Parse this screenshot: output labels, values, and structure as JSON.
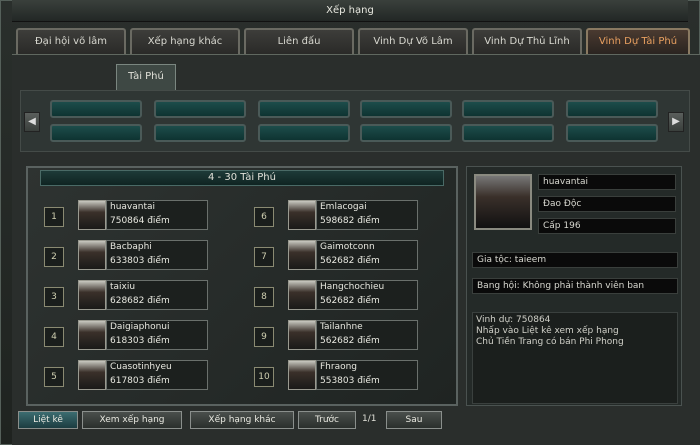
{
  "window": {
    "title": "Xếp hạng"
  },
  "tabs": [
    {
      "label": "Đại hội võ lâm",
      "active": false
    },
    {
      "label": "Xếp hạng khác",
      "active": false
    },
    {
      "label": "Liên đấu",
      "active": false
    },
    {
      "label": "Vinh Dự Võ Lâm",
      "active": false
    },
    {
      "label": "Vinh Dự Thủ Lĩnh",
      "active": false
    },
    {
      "label": "Vinh Dự Tài Phú",
      "active": true
    }
  ],
  "subtab": {
    "label": "Tài Phú"
  },
  "strip": {
    "left_arrow": "◀",
    "right_arrow": "▶"
  },
  "ranking": {
    "header": "4 - 30 Tài Phú",
    "entries": [
      {
        "rank": "1",
        "name": "huavantai",
        "score": "750864 điểm"
      },
      {
        "rank": "2",
        "name": "Bacbaphi",
        "score": "633803 điểm"
      },
      {
        "rank": "3",
        "name": "taixiu",
        "score": "628682 điểm"
      },
      {
        "rank": "4",
        "name": "Daigiaphonui",
        "score": "618303 điểm"
      },
      {
        "rank": "5",
        "name": "Cuasotinhyeu",
        "score": "617803 điểm"
      },
      {
        "rank": "6",
        "name": "Emlacogai",
        "score": "598682 điểm"
      },
      {
        "rank": "7",
        "name": "Gaimotconn",
        "score": "562682 điểm"
      },
      {
        "rank": "8",
        "name": "Hangchochieu",
        "score": "562682 điểm"
      },
      {
        "rank": "9",
        "name": "Tailanhne",
        "score": "562682 điểm"
      },
      {
        "rank": "10",
        "name": "Fhraong",
        "score": "553803 điểm"
      }
    ]
  },
  "profile": {
    "name": "huavantai",
    "faction": "Đao Độc",
    "level": "Cấp 196",
    "family": "Gia tộc: taieem",
    "guild": "Bang hội: Không phải thành viên ban",
    "notes": [
      "Vinh dự: 750864",
      "  Nhấp vào Liệt kê xem xếp hạng",
      "  Chủ Tiền Trang có bán Phi Phong"
    ]
  },
  "footer": {
    "list_button": "Liệt kê",
    "view_button": "Xem xếp hạng",
    "other_button": "Xếp hạng khác",
    "prev_button": "Trước",
    "page": "1/1",
    "next_button": "Sau"
  }
}
